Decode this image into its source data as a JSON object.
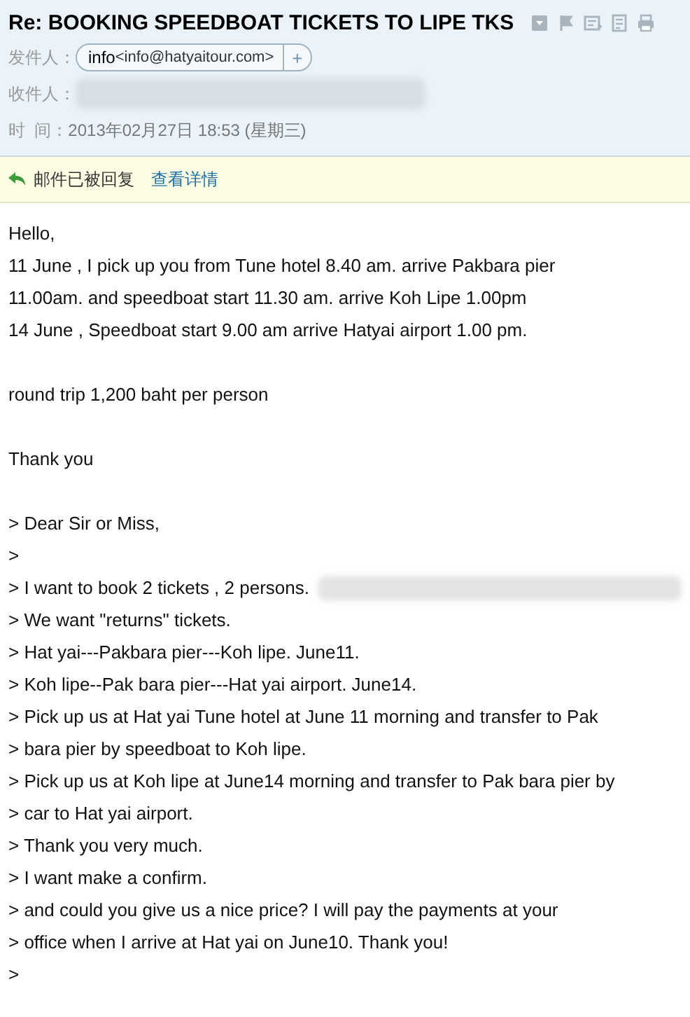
{
  "header": {
    "subject": "Re: BOOKING SPEEDBOAT TICKETS TO LIPE TKS",
    "sender": {
      "label": "发件人：",
      "name": "info",
      "address": "<info@hatyaitour.com>",
      "add": "+"
    },
    "recipient": {
      "label": "收件人：",
      "redacted": true
    },
    "time": {
      "label": "时  间：",
      "value": "2013年02月27日 18:53 (星期三)"
    }
  },
  "notice": {
    "text": "邮件已被回复",
    "link": "查看详情"
  },
  "body": {
    "paragraphs": [
      [
        "Hello,",
        "11 June , I pick up you from Tune hotel 8.40 am. arrive Pakbara pier",
        "11.00am. and speedboat start 11.30 am. arrive Koh Lipe 1.00pm",
        "14 June , Speedboat start 9.00 am arrive Hatyai airport 1.00 pm."
      ],
      [
        "round trip 1,200 baht per person"
      ],
      [
        "Thank you"
      ]
    ],
    "quote": [
      {
        "text": "> Dear Sir or Miss,",
        "redacted": false
      },
      {
        "text": ">",
        "redacted": false
      },
      {
        "text": "> I want to book 2 tickets , 2 persons.",
        "redacted": true
      },
      {
        "text": "> We want \"returns\" tickets.",
        "redacted": false
      },
      {
        "text": "> Hat yai---Pakbara pier---Koh lipe. June11.",
        "redacted": false
      },
      {
        "text": "> Koh lipe--Pak bara pier---Hat yai airport. June14.",
        "redacted": false
      },
      {
        "text": "> Pick up us at Hat yai Tune hotel at June 11 morning and transfer to Pak",
        "redacted": false
      },
      {
        "text": "> bara pier by speedboat to Koh lipe.",
        "redacted": false
      },
      {
        "text": "> Pick up us at Koh lipe at June14 morning and transfer to Pak bara pier by",
        "redacted": false
      },
      {
        "text": "> car to Hat yai airport.",
        "redacted": false
      },
      {
        "text": "> Thank you very much.",
        "redacted": false
      },
      {
        "text": "> I want make a confirm.",
        "redacted": false
      },
      {
        "text": "> and could you give us a nice price?  I will pay the payments at your",
        "redacted": false
      },
      {
        "text": "> office when I arrive at Hat yai on June10. Thank you!",
        "redacted": false
      },
      {
        "text": ">",
        "redacted": false
      }
    ]
  }
}
